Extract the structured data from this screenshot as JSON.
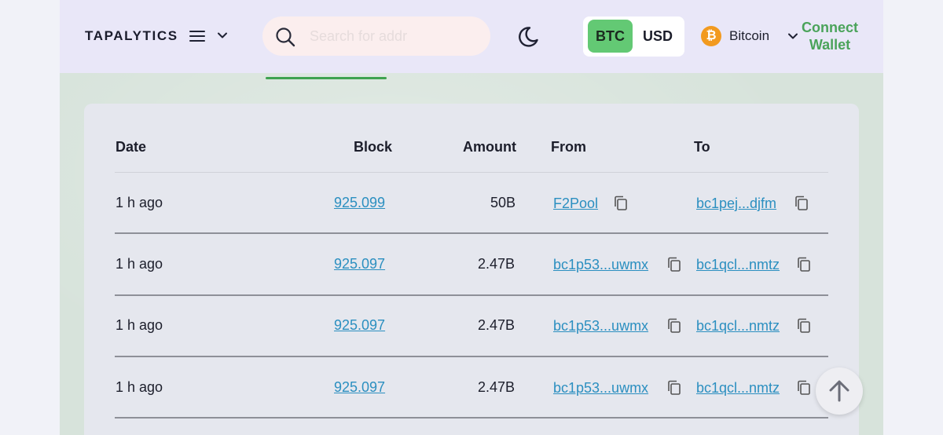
{
  "header": {
    "logo": "TAPALYTICS",
    "search_placeholder": "Search for addr",
    "currency": {
      "active": "BTC",
      "inactive": "USD"
    },
    "chain": {
      "icon": "bitcoin-icon",
      "symbol": "₿",
      "name": "Bitcoin"
    },
    "connect_wallet": "Connect Wallet"
  },
  "colors": {
    "accent_green": "#4aa35a",
    "active_toggle": "#63c974",
    "link": "#2b8fc0",
    "bitcoin_orange": "#f29a1f"
  },
  "table": {
    "columns": [
      "Date",
      "Block",
      "Amount",
      "From",
      "To"
    ],
    "rows": [
      {
        "date": "1 h ago",
        "block": "925.099",
        "amount": "50B",
        "from": "F2Pool",
        "to": "bc1pej...djfm"
      },
      {
        "date": "1 h ago",
        "block": "925.097",
        "amount": "2.47B",
        "from": "bc1p53...uwmx",
        "to": "bc1qcl...nmtz"
      },
      {
        "date": "1 h ago",
        "block": "925.097",
        "amount": "2.47B",
        "from": "bc1p53...uwmx",
        "to": "bc1qcl...nmtz"
      },
      {
        "date": "1 h ago",
        "block": "925.097",
        "amount": "2.47B",
        "from": "bc1p53...uwmx",
        "to": "bc1qcl...nmtz"
      }
    ]
  }
}
